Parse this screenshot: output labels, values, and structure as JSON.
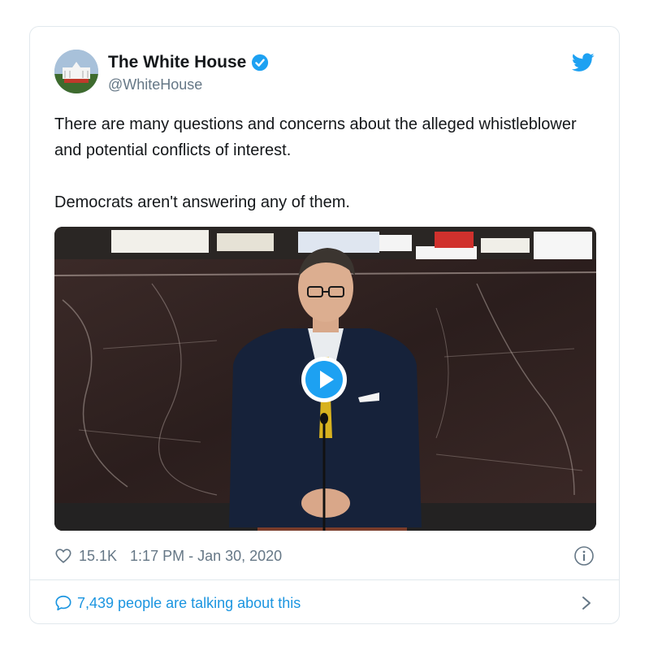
{
  "tweet": {
    "author_name": "The White House",
    "author_handle": "@WhiteHouse",
    "text": "There are many questions and concerns about the alleged whistleblower and potential conflicts of interest.\n\nDemocrats aren't answering any of them.",
    "likes": "15.1K",
    "timestamp": "1:17 PM - Jan 30, 2020",
    "conversation_label": "7,439 people are talking about this"
  },
  "icons": {
    "verified": "verified-badge-icon",
    "brand": "twitter-bird-icon",
    "play": "play-icon",
    "like": "heart-icon",
    "info": "info-icon",
    "reply": "speech-bubble-icon",
    "next": "chevron-right-icon"
  },
  "colors": {
    "accent": "#1da1f2",
    "link": "#1b95e0",
    "muted": "#657786",
    "border": "#e1e8ed"
  }
}
